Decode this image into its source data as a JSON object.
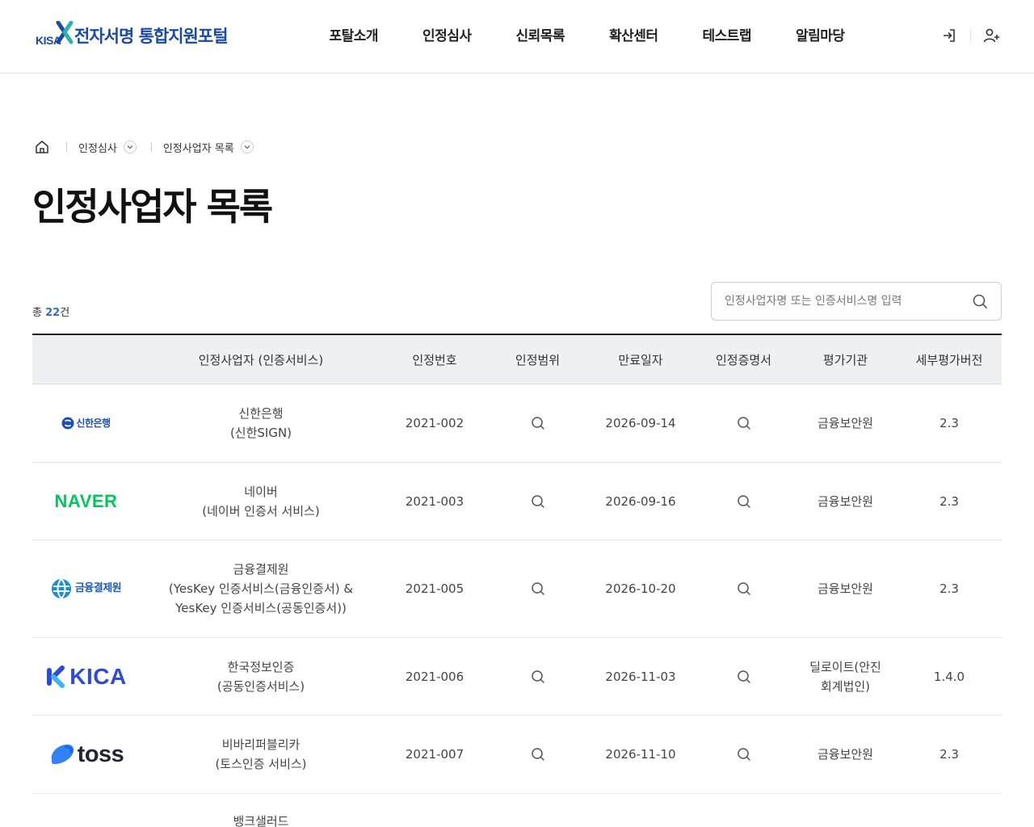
{
  "header": {
    "logo_text": "KISA",
    "site_title": "전자서명 통합지원포털",
    "nav": [
      "포탈소개",
      "인정심사",
      "신뢰목록",
      "확산센터",
      "테스트랩",
      "알림마당"
    ],
    "login_icon": "login-icon",
    "join_icon": "add-user-icon"
  },
  "breadcrumb": {
    "home_icon": "home-icon",
    "items": [
      "인정심사",
      "인정사업자 목록"
    ]
  },
  "page_title": "인정사업자 목록",
  "count": {
    "prefix": "총",
    "value": "22",
    "suffix": "건"
  },
  "search": {
    "placeholder": "인정사업자명 또는 인증서비스명 입력",
    "value": ""
  },
  "table": {
    "headers": [
      "",
      "인정사업자 (인증서비스)",
      "인정번호",
      "인정범위",
      "만료일자",
      "인정증명서",
      "평가기관",
      "세부평가버전"
    ],
    "rows": [
      {
        "logo": "신한은행",
        "name": "신한은행",
        "service": "(신한SIGN)",
        "number": "2021-002",
        "expiry": "2026-09-14",
        "org": "금융보안원",
        "org2": "",
        "version": "2.3"
      },
      {
        "logo": "NAVER",
        "name": "네이버",
        "service": "(네이버 인증서 서비스)",
        "number": "2021-003",
        "expiry": "2026-09-16",
        "org": "금융보안원",
        "org2": "",
        "version": "2.3"
      },
      {
        "logo": "금융결제원",
        "name": "금융결제원",
        "service": "(YesKey 인증서비스(금융인증서) &",
        "service2": "YesKey 인증서비스(공동인증서))",
        "number": "2021-005",
        "expiry": "2026-10-20",
        "org": "금융보안원",
        "org2": "",
        "version": "2.3"
      },
      {
        "logo": "KICA",
        "name": "한국정보인증",
        "service": "(공동인증서비스)",
        "number": "2021-006",
        "expiry": "2026-11-03",
        "org": "딜로이트(안진",
        "org2": "회계법인)",
        "version": "1.4.0"
      },
      {
        "logo": "toss",
        "name": "비바리퍼블리카",
        "service": "(토스인증 서비스)",
        "number": "2021-007",
        "expiry": "2026-11-10",
        "org": "금융보안원",
        "org2": "",
        "version": "2.3"
      },
      {
        "logo": "",
        "name": "뱅크샐러드",
        "service": "",
        "number": "",
        "expiry": "",
        "org": "",
        "org2": "",
        "version": ""
      }
    ]
  },
  "colors": {
    "brand": "#1a4aa5",
    "accent": "#2a6fdb",
    "naver": "#03c75a",
    "kica": "#2c4bd8",
    "toss": "#3182f6"
  }
}
